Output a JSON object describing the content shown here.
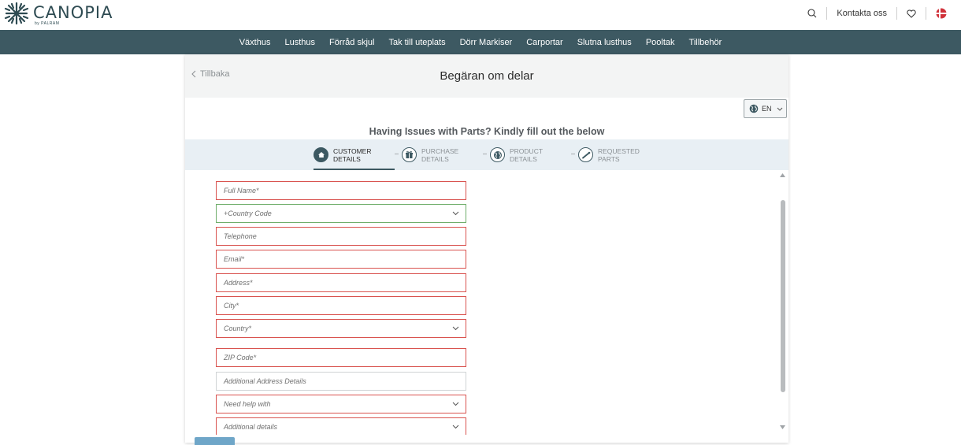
{
  "brand": {
    "name": "CANOPIA",
    "sub": "by PALRAM"
  },
  "utility": {
    "contact": "Kontakta oss"
  },
  "nav": [
    "Växthus",
    "Lusthus",
    "Förråd skjul",
    "Tak till uteplats",
    "Dörr Markiser",
    "Carportar",
    "Slutna lusthus",
    "Pooltak",
    "Tillbehör"
  ],
  "card": {
    "back": "Tillbaka",
    "title": "Begäran om delar",
    "language": "EN",
    "heading": "Having Issues with Parts? Kindly fill out the below"
  },
  "steps": [
    {
      "line1": "CUSTOMER",
      "line2": "DETAILS",
      "icon": "home-icon",
      "active": true
    },
    {
      "line1": "PURCHASE",
      "line2": "DETAILS",
      "icon": "gift-icon",
      "active": false
    },
    {
      "line1": "PRODUCT",
      "line2": "DETAILS",
      "icon": "globe-icon",
      "active": false
    },
    {
      "line1": "REQUESTED",
      "line2": "PARTS",
      "icon": "tool-icon",
      "active": false
    }
  ],
  "form": {
    "full_name": "Full Name*",
    "country_code": "+Country Code",
    "telephone": "Telephone",
    "email": "Email*",
    "address": "Address*",
    "city": "City*",
    "country": "Country*",
    "zip": "ZIP Code*",
    "additional_address": "Additional Address Details",
    "need_help": "Need help with",
    "additional_details": "Additional details"
  },
  "colors": {
    "nav_bg": "#3d5962",
    "error": "#d9534f",
    "valid": "#6fae6b",
    "steps_bg": "#e8eff4"
  }
}
